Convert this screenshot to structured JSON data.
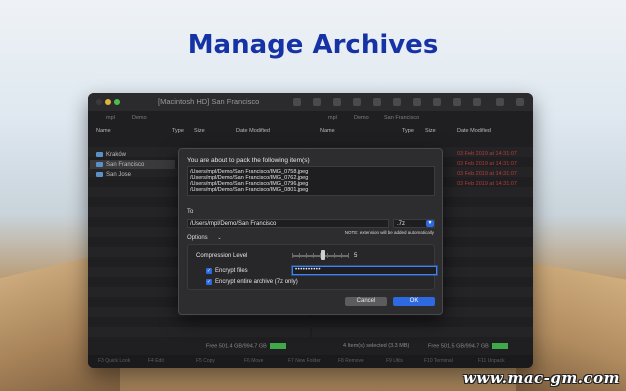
{
  "headline": "Manage Archives",
  "window": {
    "title": "[Macintosh HD] San Francisco",
    "left_panel": {
      "path": [
        "mpl",
        "Demo"
      ],
      "columns": [
        "Name",
        "Type",
        "Size",
        "Date Modified"
      ],
      "rows": [
        "Kraków",
        "San Francisco",
        "San Jose"
      ],
      "selected_row": "San Francisco",
      "status_free": "Free 501.4 GB/994.7 GB"
    },
    "right_panel": {
      "path": [
        "mpl",
        "Demo",
        "San Francisco"
      ],
      "columns": [
        "Name",
        "Type",
        "Size",
        "Date Modified"
      ],
      "dates": [
        "03 Feb 2019 at 14:31:07",
        "03 Feb 2019 at 14:31:07",
        "03 Feb 2019 at 14:31:07",
        "03 Feb 2019 at 14:31:07"
      ],
      "status_selected": "4 Item(s) selected (3.3 MB)",
      "status_free": "Free 501.5 GB/994.7 GB"
    },
    "fkeys": [
      "F3 Quick Look",
      "F4 Edit",
      "F5 Copy",
      "F6 Move",
      "F7 New Folder",
      "F8 Remove",
      "F9 Utils",
      "F10 Terminal",
      "F11 Unpack"
    ]
  },
  "dialog": {
    "heading": "You are about to pack the following item(s)",
    "items": [
      "/Users/mpl/Demo/San Francisco/IMG_0758.jpeg",
      "/Users/mpl/Demo/San Francisco/IMG_0762.jpeg",
      "/Users/mpl/Demo/San Francisco/IMG_0796.jpeg",
      "/Users/mpl/Demo/San Francisco/IMG_0801.jpeg"
    ],
    "to_label": "To",
    "destination": "/Users/mpl/Demo/San Francisco",
    "format": ".7z",
    "note": "NOTE: extension will be added automatically",
    "options_label": "Options",
    "compression_label": "Compression Level",
    "compression_value": "5",
    "compression_level": 5,
    "compression_max": 9,
    "encrypt_files_label": "Encrypt files",
    "encrypt_files_checked": true,
    "password": "••••••••••",
    "encrypt_archive_label": "Encrypt entire archive (7z only)",
    "encrypt_archive_checked": true,
    "cancel_label": "Cancel",
    "ok_label": "OK"
  },
  "watermark": "www.mac-gm.com",
  "colors": {
    "headline": "#1633a6",
    "accent": "#2d6ae0",
    "date_red": "#b33a3a",
    "free_bar": "#3fa848"
  }
}
